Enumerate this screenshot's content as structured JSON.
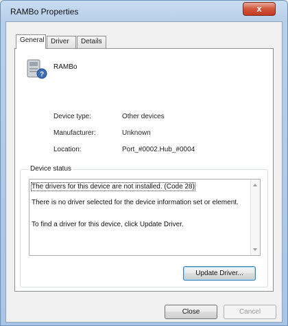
{
  "window": {
    "title": "RAMBo Properties",
    "close_glyph": "x"
  },
  "tabs": [
    {
      "label": "General",
      "active": true
    },
    {
      "label": "Driver",
      "active": false
    },
    {
      "label": "Details",
      "active": false
    }
  ],
  "device": {
    "name": "RAMBo",
    "icon": "unknown-device-icon"
  },
  "properties": [
    {
      "label": "Device type:",
      "value": "Other devices"
    },
    {
      "label": "Manufacturer:",
      "value": "Unknown"
    },
    {
      "label": "Location:",
      "value": "Port_#0002.Hub_#0004"
    }
  ],
  "device_status": {
    "label": "Device status",
    "lines": [
      "The drivers for this device are not installed. (Code 28)",
      "There is no driver selected for the device information set or element.",
      "To find a driver for this device, click Update Driver."
    ]
  },
  "buttons": {
    "update_driver": "Update Driver...",
    "close": "Close",
    "cancel": "Cancel"
  }
}
